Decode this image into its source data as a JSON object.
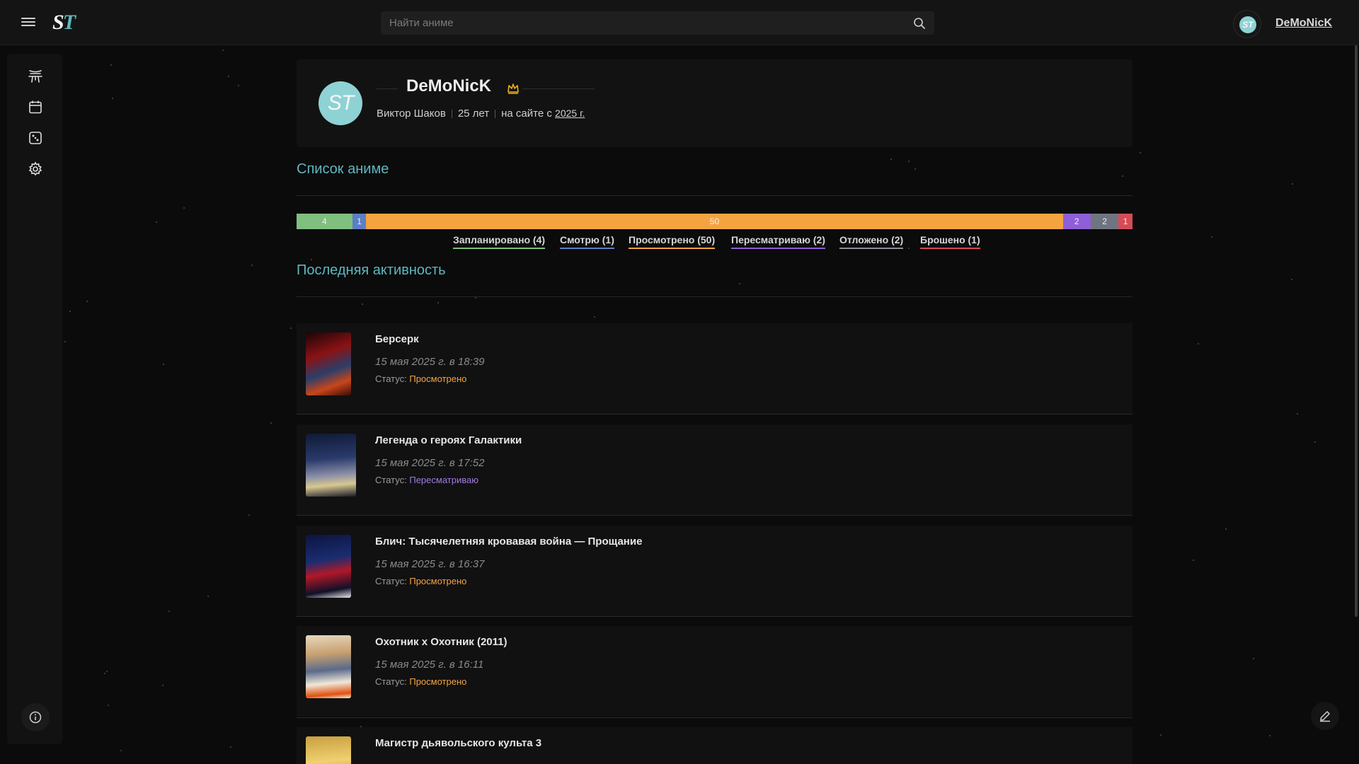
{
  "header": {
    "logo_s": "S",
    "logo_t": "T",
    "search_placeholder": "Найти аниме",
    "avatar_initials": "ST",
    "username": "DeMoNicK"
  },
  "sidebar": {
    "items": [
      {
        "name": "anime-icon"
      },
      {
        "name": "calendar-icon"
      },
      {
        "name": "dice-icon"
      },
      {
        "name": "gear-icon"
      }
    ]
  },
  "profile": {
    "avatar_initials": "ST",
    "name": "DeMoNicK",
    "real_name": "Виктор Шаков",
    "age": "25 лет",
    "since_prefix": "на сайте с",
    "since_year": "2025 г."
  },
  "anime_list": {
    "title": "Список аниме",
    "segments": [
      {
        "label": "4",
        "count": 4,
        "color": "#7fbf7f"
      },
      {
        "label": "1",
        "count": 1,
        "color": "#5b7fc5"
      },
      {
        "label": "50",
        "count": 50,
        "color": "#f5a341"
      },
      {
        "label": "2",
        "count": 2,
        "color": "#8e5fd6"
      },
      {
        "label": "2",
        "count": 2,
        "color": "#6f7480"
      },
      {
        "label": "1",
        "count": 1,
        "color": "#d64b55"
      }
    ],
    "legend": [
      {
        "label": "Запланировано (4)",
        "color": "#7fbf7f"
      },
      {
        "label": "Смотрю (1)",
        "color": "#5b7fc5"
      },
      {
        "label": "Просмотрено (50)",
        "color": "#f5a341"
      },
      {
        "label": "Пересматриваю (2)",
        "color": "#8e5fd6"
      },
      {
        "label": "Отложено (2)",
        "color": "#8a8f98"
      },
      {
        "label": "Брошено (1)",
        "color": "#d64b55"
      }
    ]
  },
  "activity": {
    "title": "Последняя активность",
    "status_prefix": "Статус:",
    "items": [
      {
        "title": "Берсерк",
        "date": "15 мая 2025 г. в 18:39",
        "status": "Просмотрено",
        "status_color": "#f5a341"
      },
      {
        "title": "Легенда о героях Галактики",
        "date": "15 мая 2025 г. в 17:52",
        "status": "Пересматриваю",
        "status_color": "#a07be0"
      },
      {
        "title": "Блич: Тысячелетняя кровавая война — Прощание",
        "date": "15 мая 2025 г. в 16:37",
        "status": "Просмотрено",
        "status_color": "#f5a341"
      },
      {
        "title": "Охотник х Охотник (2011)",
        "date": "15 мая 2025 г. в 16:11",
        "status": "Просмотрено",
        "status_color": "#f5a341"
      },
      {
        "title": "Магистр дьявольского культа 3",
        "date": "",
        "status": "",
        "status_color": "#f5a341"
      }
    ]
  }
}
